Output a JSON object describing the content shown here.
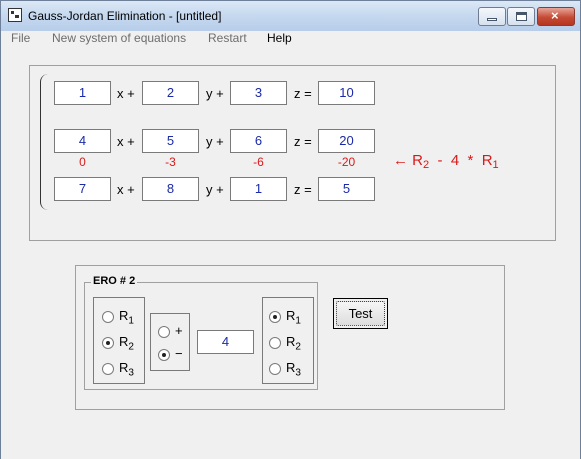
{
  "window": {
    "title": "Gauss-Jordan Elimination - [untitled]",
    "close_glyph": "×"
  },
  "menu": {
    "file": "File",
    "new_system": "New system of equations",
    "restart": "Restart",
    "help": "Help"
  },
  "equations": {
    "row1": {
      "x": "1",
      "y": "2",
      "z": "3",
      "rhs": "10"
    },
    "row2": {
      "x": "4",
      "y": "5",
      "z": "6",
      "rhs": "20"
    },
    "row3": {
      "x": "7",
      "y": "8",
      "z": "1",
      "rhs": "5"
    },
    "var_x": "x +",
    "var_y": "y +",
    "var_z": "z =",
    "result_row": {
      "x": "0",
      "y": "-3",
      "z": "-6",
      "rhs": "-20"
    },
    "row_operation": {
      "arrow": "←",
      "target_r": "R",
      "target_sub": "2",
      "op": "-",
      "factor": "4",
      "times": "*",
      "source_r": "R",
      "source_sub": "1"
    }
  },
  "ero": {
    "caption": "ERO # 2",
    "left_rows": [
      {
        "r": "R",
        "sub": "1",
        "selected": false
      },
      {
        "r": "R",
        "sub": "2",
        "selected": true
      },
      {
        "r": "R",
        "sub": "3",
        "selected": false
      }
    ],
    "signs": [
      {
        "label": "+",
        "selected": false
      },
      {
        "label": "−",
        "selected": true
      }
    ],
    "multiplier": "4",
    "right_rows": [
      {
        "r": "R",
        "sub": "1",
        "selected": true
      },
      {
        "r": "R",
        "sub": "2",
        "selected": false
      },
      {
        "r": "R",
        "sub": "3",
        "selected": false
      }
    ],
    "test_label": "Test"
  }
}
